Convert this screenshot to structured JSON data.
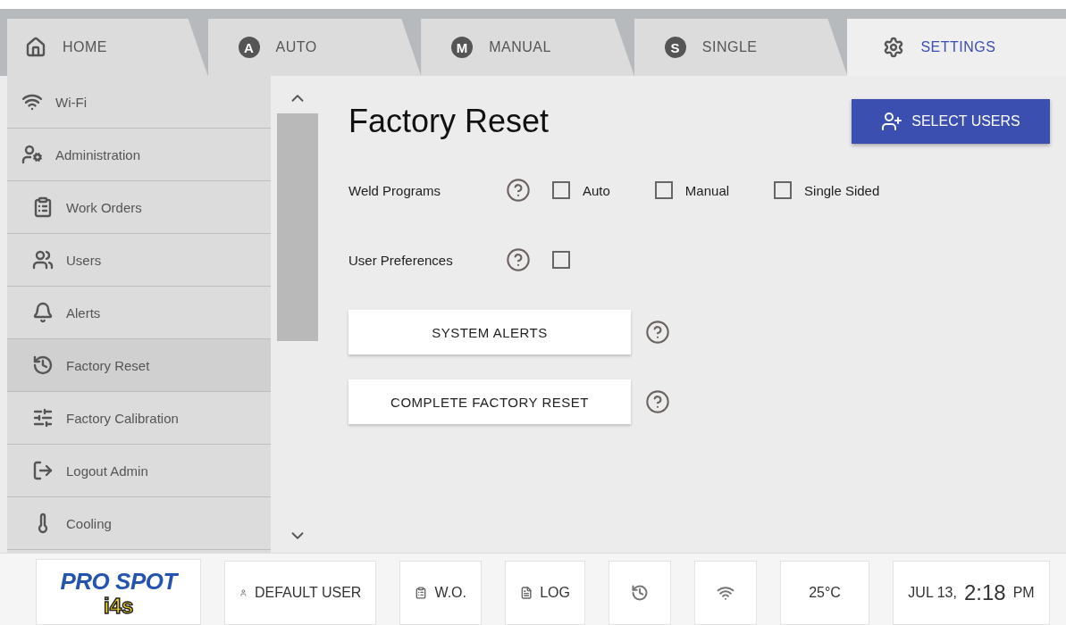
{
  "tabs": [
    {
      "label": "HOME",
      "selected": false
    },
    {
      "label": "AUTO",
      "badge": "A",
      "selected": false
    },
    {
      "label": "MANUAL",
      "badge": "M",
      "selected": false
    },
    {
      "label": "SINGLE",
      "badge": "S",
      "selected": false
    },
    {
      "label": "SETTINGS",
      "selected": true
    }
  ],
  "sidebar": {
    "items": [
      {
        "label": "Wi-Fi",
        "selected": false
      },
      {
        "label": "Administration",
        "selected": false
      },
      {
        "label": "Work Orders",
        "selected": false
      },
      {
        "label": "Users",
        "selected": false
      },
      {
        "label": "Alerts",
        "selected": false
      },
      {
        "label": "Factory Reset",
        "selected": true
      },
      {
        "label": "Factory Calibration",
        "selected": false
      },
      {
        "label": "Logout Admin",
        "selected": false
      },
      {
        "label": "Cooling",
        "selected": false
      }
    ]
  },
  "content": {
    "title": "Factory Reset",
    "select_users_button": "SELECT USERS",
    "options": [
      {
        "label": "Weld Programs",
        "choices": [
          {
            "label": "Auto",
            "checked": false
          },
          {
            "label": "Manual",
            "checked": false
          },
          {
            "label": "Single Sided",
            "checked": false
          }
        ]
      },
      {
        "label": "User Preferences",
        "checked": false
      }
    ],
    "actions": [
      {
        "label": "SYSTEM ALERTS"
      },
      {
        "label": "COMPLETE FACTORY RESET"
      }
    ]
  },
  "status_bar": {
    "logo": {
      "name": "PRO SPOT",
      "product": "i4s"
    },
    "items": [
      {
        "kind": "text",
        "label": "DEFAULT USER"
      },
      {
        "kind": "text",
        "label": "W.O."
      },
      {
        "kind": "text",
        "label": "LOG"
      },
      {
        "kind": "icon"
      },
      {
        "kind": "icon"
      },
      {
        "kind": "text",
        "label": "25°C"
      },
      {
        "kind": "clock",
        "date": "JUL 13,",
        "time": "2:18",
        "ampm": "PM"
      }
    ]
  }
}
